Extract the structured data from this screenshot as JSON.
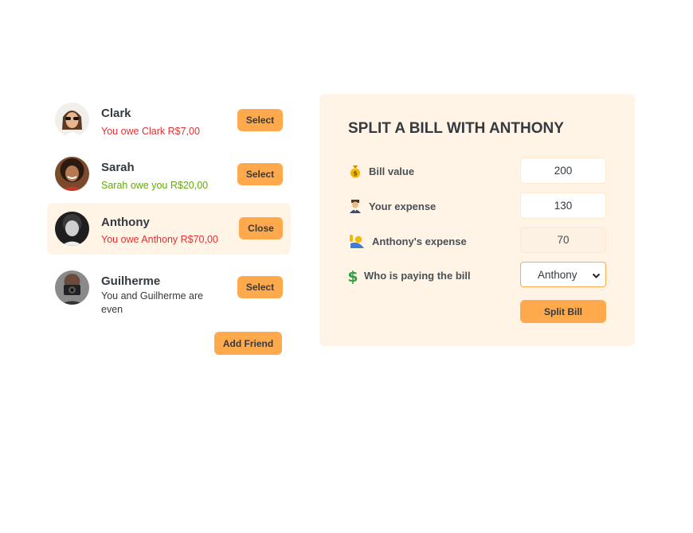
{
  "friends": [
    {
      "name": "Clark",
      "status": "You owe Clark R$7,00",
      "status_tone": "red",
      "button": "Select",
      "selected": false
    },
    {
      "name": "Sarah",
      "status": "Sarah owe you R$20,00",
      "status_tone": "green",
      "button": "Select",
      "selected": false
    },
    {
      "name": "Anthony",
      "status": "You owe Anthony R$70,00",
      "status_tone": "red",
      "button": "Close",
      "selected": true
    },
    {
      "name": "Guilherme",
      "status": "You and Guilherme are even",
      "status_tone": "neutral",
      "button": "Select",
      "selected": false
    }
  ],
  "add_friend_label": "Add Friend",
  "form": {
    "title": "SPLIT A BILL WITH ANTHONY",
    "bill_value_label": "Bill value",
    "bill_value": "200",
    "bill_icon": "money-bag-icon",
    "your_expense_label": "Your expense",
    "your_expense": "130",
    "your_expense_icon": "person-icon",
    "friend_expense_label": "Anthony's expense",
    "friend_expense": "70",
    "friend_expense_icon": "raising-hand-icon",
    "payer_label": "Who is paying the bill",
    "payer_value": "Anthony",
    "payer_icon": "dollar-icon",
    "split_button": "Split Bill"
  },
  "colors": {
    "accent": "#ffa94d",
    "panel_bg": "#fff4e6",
    "owe_red": "#e03131",
    "owed_green": "#66a80f"
  }
}
